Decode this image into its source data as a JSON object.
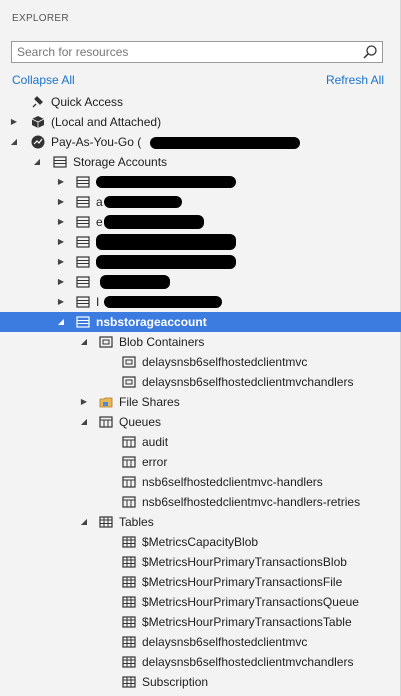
{
  "panel": {
    "title": "EXPLORER",
    "search_placeholder": "Search for resources",
    "collapse_all": "Collapse All",
    "refresh_all": "Refresh All"
  },
  "tree": {
    "quick_access": "Quick Access",
    "local_attached": "(Local and Attached)",
    "subscription": "Pay-As-You-Go (",
    "storage_accounts": "Storage Accounts",
    "redacted_account_fragments": [
      "a",
      "e",
      "I"
    ],
    "account": "nsbstorageaccount",
    "blob_containers": "Blob Containers",
    "blobs": [
      "delaysnsb6selfhostedclientmvc",
      "delaysnsb6selfhostedclientmvchandlers"
    ],
    "file_shares": "File Shares",
    "queues_label": "Queues",
    "queues": [
      "audit",
      "error",
      "nsb6selfhostedclientmvc-handlers",
      "nsb6selfhostedclientmvc-handlers-retries"
    ],
    "tables_label": "Tables",
    "tables": [
      "$MetricsCapacityBlob",
      "$MetricsHourPrimaryTransactionsBlob",
      "$MetricsHourPrimaryTransactionsFile",
      "$MetricsHourPrimaryTransactionsQueue",
      "$MetricsHourPrimaryTransactionsTable",
      "delaysnsb6selfhostedclientmvc",
      "delaysnsb6selfhostedclientmvchandlers",
      "Subscription"
    ]
  },
  "colors": {
    "selection": "#3c7be0",
    "link": "#1a73c8",
    "panel_bg": "#f3f3f3"
  }
}
